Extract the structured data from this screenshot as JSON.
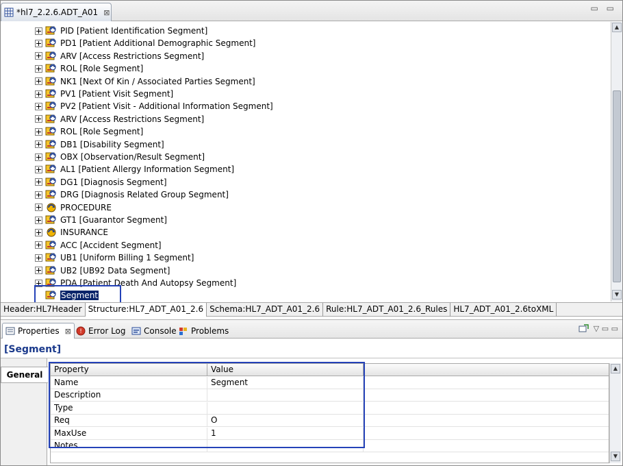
{
  "editor": {
    "tab_title": "*hl7_2.2.6.ADT_A01",
    "close_glyph": "⊠",
    "window_controls": "▭ ▭"
  },
  "tree": {
    "items": [
      {
        "label": "PID [Patient Identification Segment]",
        "icon": "segment-icon"
      },
      {
        "label": "PD1 [Patient Additional Demographic Segment]",
        "icon": "segment-icon"
      },
      {
        "label": "ARV [Access Restrictions Segment]",
        "icon": "segment-icon"
      },
      {
        "label": "ROL [Role Segment]",
        "icon": "segment-icon"
      },
      {
        "label": "NK1 [Next Of Kin / Associated Parties Segment]",
        "icon": "segment-icon"
      },
      {
        "label": "PV1 [Patient Visit Segment]",
        "icon": "segment-icon"
      },
      {
        "label": "PV2 [Patient Visit - Additional Information Segment]",
        "icon": "segment-icon"
      },
      {
        "label": "ARV [Access Restrictions Segment]",
        "icon": "segment-icon"
      },
      {
        "label": "ROL [Role Segment]",
        "icon": "segment-icon"
      },
      {
        "label": "DB1 [Disability Segment]",
        "icon": "segment-icon"
      },
      {
        "label": "OBX [Observation/Result Segment]",
        "icon": "segment-icon"
      },
      {
        "label": "AL1 [Patient Allergy Information Segment]",
        "icon": "segment-icon"
      },
      {
        "label": "DG1 [Diagnosis Segment]",
        "icon": "segment-icon"
      },
      {
        "label": "DRG [Diagnosis Related Group Segment]",
        "icon": "segment-icon"
      },
      {
        "label": "PROCEDURE",
        "icon": "group-icon"
      },
      {
        "label": "GT1 [Guarantor Segment]",
        "icon": "segment-icon"
      },
      {
        "label": "INSURANCE",
        "icon": "group-icon"
      },
      {
        "label": "ACC [Accident Segment]",
        "icon": "segment-icon"
      },
      {
        "label": "UB1 [Uniform Billing 1 Segment]",
        "icon": "segment-icon"
      },
      {
        "label": "UB2 [UB92 Data Segment]",
        "icon": "segment-icon"
      },
      {
        "label": "PDA [Patient Death And Autopsy Segment]",
        "icon": "segment-icon"
      },
      {
        "label": "Segment",
        "icon": "segment-icon",
        "selected": true
      }
    ]
  },
  "page_tabs": [
    {
      "label": "Header:HL7Header",
      "active": false
    },
    {
      "label": "Structure:HL7_ADT_A01_2.6",
      "active": true
    },
    {
      "label": "Schema:HL7_ADT_A01_2.6",
      "active": false
    },
    {
      "label": "Rule:HL7_ADT_A01_2.6_Rules",
      "active": false
    },
    {
      "label": "HL7_ADT_A01_2.6toXML",
      "active": false
    }
  ],
  "views": {
    "properties": "Properties",
    "error_log": "Error Log",
    "console": "Console",
    "problems": "Problems",
    "close_glyph": "⊠",
    "controls": "▽ ▭ ▭"
  },
  "properties": {
    "title": "[Segment]",
    "side_tab": "General",
    "columns": [
      "Property",
      "Value"
    ],
    "rows": [
      {
        "property": "Name",
        "value": "Segment"
      },
      {
        "property": "Description",
        "value": ""
      },
      {
        "property": "Type",
        "value": ""
      },
      {
        "property": "Req",
        "value": "O"
      },
      {
        "property": "MaxUse",
        "value": "1"
      },
      {
        "property": "Notes",
        "value": ""
      }
    ]
  },
  "colors": {
    "selection": "#0a246a",
    "highlight_box": "#2442b8",
    "title_blue": "#1b3a8c"
  }
}
